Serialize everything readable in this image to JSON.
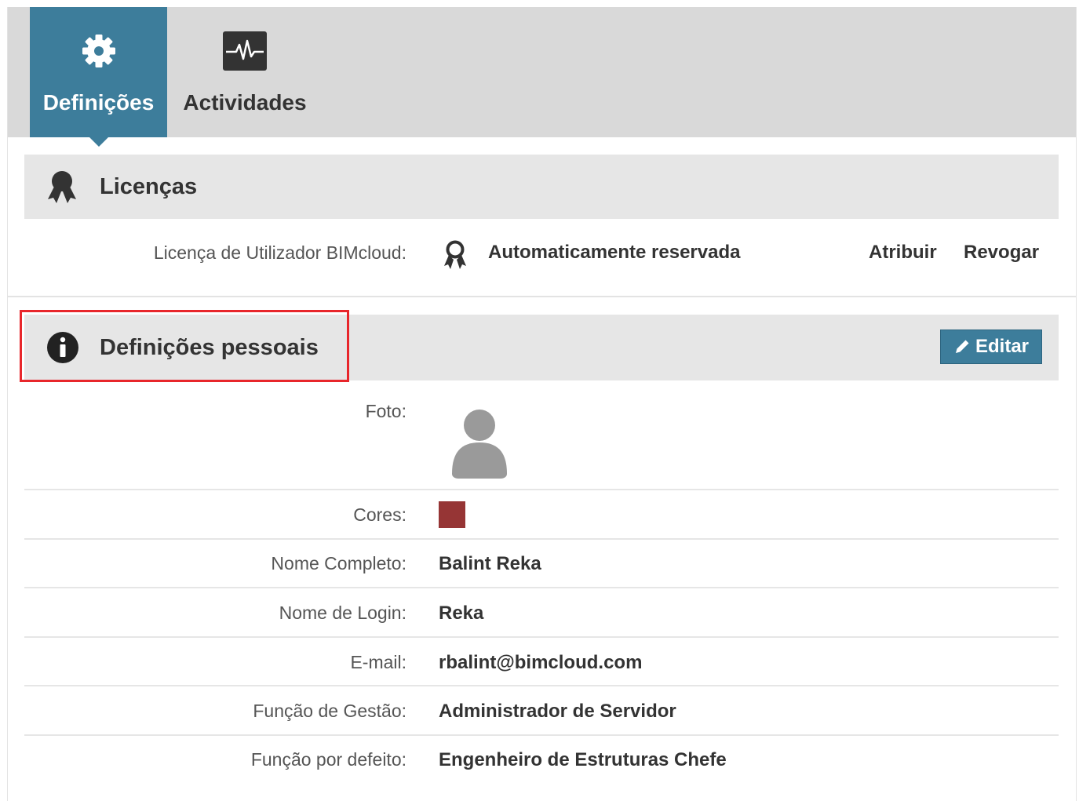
{
  "tabs": [
    {
      "label": "Definições",
      "icon": "gear-icon",
      "active": true
    },
    {
      "label": "Actividades",
      "icon": "activity-monitor-icon",
      "active": false
    }
  ],
  "licenses": {
    "title": "Licenças",
    "icon": "award-ribbon-icon",
    "row_label": "Licença de Utilizador BIMcloud:",
    "value": "Automaticamente reservada",
    "assign_label": "Atribuir",
    "revoke_label": "Revogar"
  },
  "personal": {
    "title": "Definições pessoais",
    "icon": "info-icon",
    "edit_label": "Editar",
    "photo_label": "Foto:",
    "colors_label": "Cores:",
    "user_color": "#963535",
    "full_name_label": "Nome Completo:",
    "full_name": "Balint Reka",
    "login_label": "Nome de Login:",
    "login": "Reka",
    "email_label": "E-mail:",
    "email": "rbalint@bimcloud.com",
    "management_role_label": "Função de Gestão:",
    "management_role": "Administrador de Servidor",
    "default_role_label": "Função por defeito:",
    "default_role": "Engenheiro de Estruturas Chefe"
  },
  "colors": {
    "accent": "#3d7d9b",
    "highlight": "#e8262b"
  }
}
